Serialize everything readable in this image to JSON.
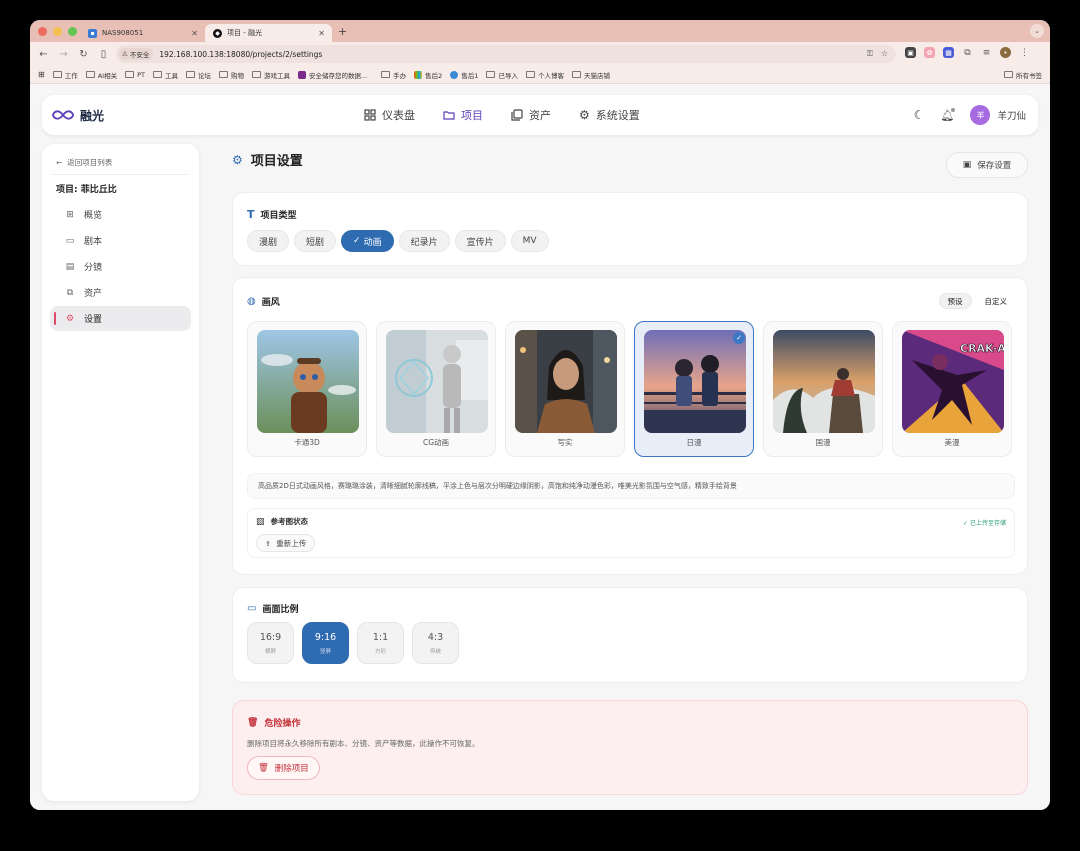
{
  "browser": {
    "tabs": [
      {
        "title": "NAS908051"
      },
      {
        "title": "项目 - 融光"
      }
    ],
    "insecure_label": "不安全",
    "url": "192.168.100.138:18080/projects/2/settings",
    "bookmarks": [
      "工作",
      "AI相关",
      "PT",
      "工具",
      "论坛",
      "购物",
      "游戏工具",
      "安全储存您的数据...",
      "手办",
      "售后2",
      "售后1",
      "已导入",
      "个人博客",
      "天猫店铺"
    ],
    "all_bookmarks": "所有书签"
  },
  "app": {
    "brand": "融光",
    "nav": [
      {
        "label": "仪表盘",
        "icon": "dashboard-icon"
      },
      {
        "label": "项目",
        "icon": "folder-icon"
      },
      {
        "label": "资产",
        "icon": "images-icon"
      },
      {
        "label": "系统设置",
        "icon": "gear-icon"
      }
    ],
    "active_nav": "项目",
    "user": {
      "avatar_text": "羊",
      "name": "羊刀仙"
    }
  },
  "sidebar": {
    "back_label": "返回项目列表",
    "project_title": "项目: 菲比丘比",
    "items": [
      {
        "label": "概览",
        "icon": "grid-icon"
      },
      {
        "label": "剧本",
        "icon": "book-icon"
      },
      {
        "label": "分镜",
        "icon": "film-icon"
      },
      {
        "label": "资产",
        "icon": "images-icon"
      },
      {
        "label": "设置",
        "icon": "gear-icon"
      }
    ],
    "active": "设置"
  },
  "main": {
    "title": "项目设置",
    "save_label": "保存设置",
    "project_type": {
      "title": "项目类型",
      "options": [
        "漫剧",
        "短剧",
        "动画",
        "纪录片",
        "宣传片",
        "MV"
      ],
      "selected": "动画"
    },
    "style": {
      "title": "画风",
      "tabs": [
        "预设",
        "自定义"
      ],
      "active_tab": "预设",
      "options": [
        "卡通3D",
        "CG动画",
        "写实",
        "日漫",
        "国漫",
        "美漫"
      ],
      "selected": "日漫",
      "american_comic_text": "CRAK-A",
      "description": "高品质2D日式动画风格，赛璐璐涂装，清晰细腻轮廓线稿，平涂上色与层次分明硬边缘阴影，高饱和纯净动漫色彩，唯美光影氛围与空气感，精致手绘背景",
      "reference": {
        "title": "参考图状态",
        "status": "已上传至存储",
        "reupload_label": "重新上传"
      }
    },
    "aspect": {
      "title": "画面比例",
      "options": [
        {
          "value": "16:9",
          "label": "横屏"
        },
        {
          "value": "9:16",
          "label": "竖屏"
        },
        {
          "value": "1:1",
          "label": "方形"
        },
        {
          "value": "4:3",
          "label": "传统"
        }
      ],
      "selected": "9:16"
    },
    "danger": {
      "title": "危险操作",
      "description": "删除项目将永久移除所有剧本、分镜、资产等数据，此操作不可恢复。",
      "delete_label": "删除项目"
    }
  }
}
